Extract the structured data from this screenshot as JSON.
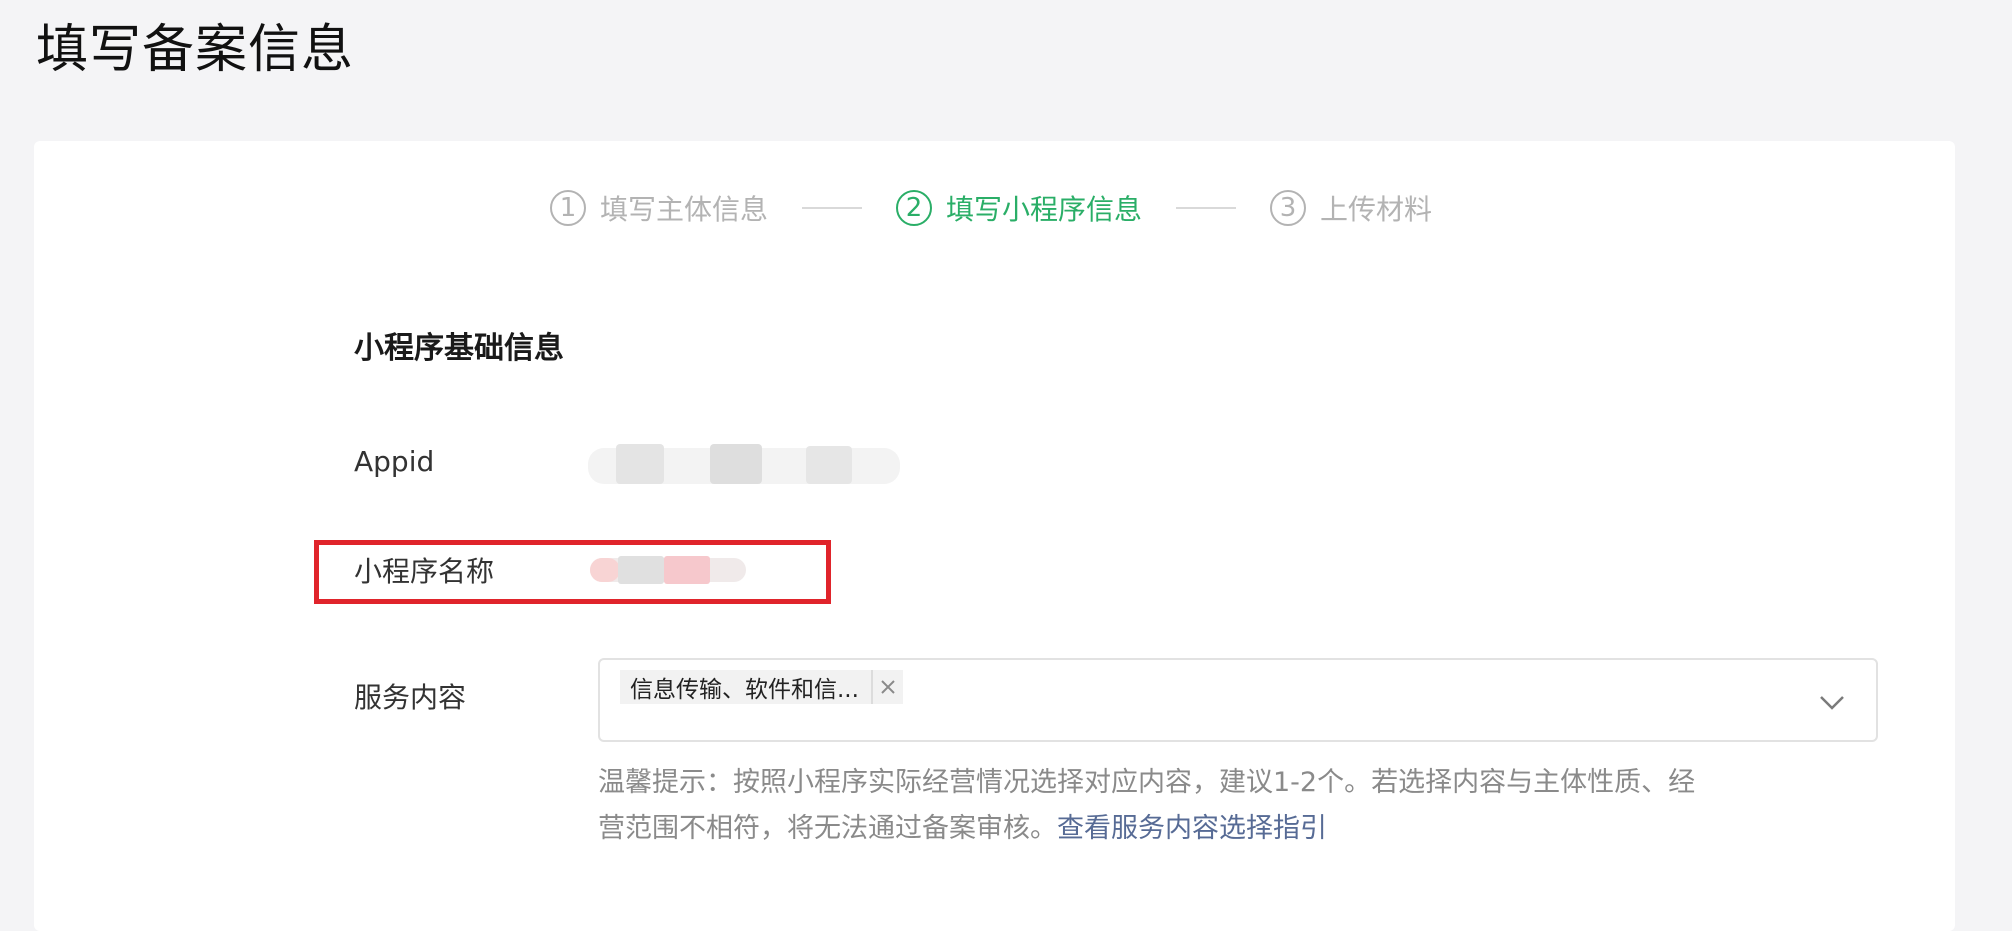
{
  "page": {
    "title": "填写备案信息"
  },
  "stepper": {
    "steps": [
      {
        "number": "1",
        "label": "填写主体信息",
        "state": "done"
      },
      {
        "number": "2",
        "label": "填写小程序信息",
        "state": "active"
      },
      {
        "number": "3",
        "label": "上传材料",
        "state": "pending"
      }
    ],
    "active_color": "#2aae67",
    "inactive_color": "#b3b3b3"
  },
  "section": {
    "title": "小程序基础信息"
  },
  "fields": {
    "appid": {
      "label": "Appid"
    },
    "name": {
      "label": "小程序名称"
    },
    "service": {
      "label": "服务内容",
      "selected_tag": "信息传输、软件和信...",
      "tag_remove_icon": "close-icon",
      "dropdown_icon": "chevron-down-icon"
    }
  },
  "hint": {
    "text": "温馨提示：按照小程序实际经营情况选择对应内容，建议1-2个。若选择内容与主体性质、经营范围不相符，将无法通过备案审核。",
    "link_text": "查看服务内容选择指引",
    "link_color": "#576b95"
  },
  "highlight": {
    "color": "#e0242b"
  }
}
